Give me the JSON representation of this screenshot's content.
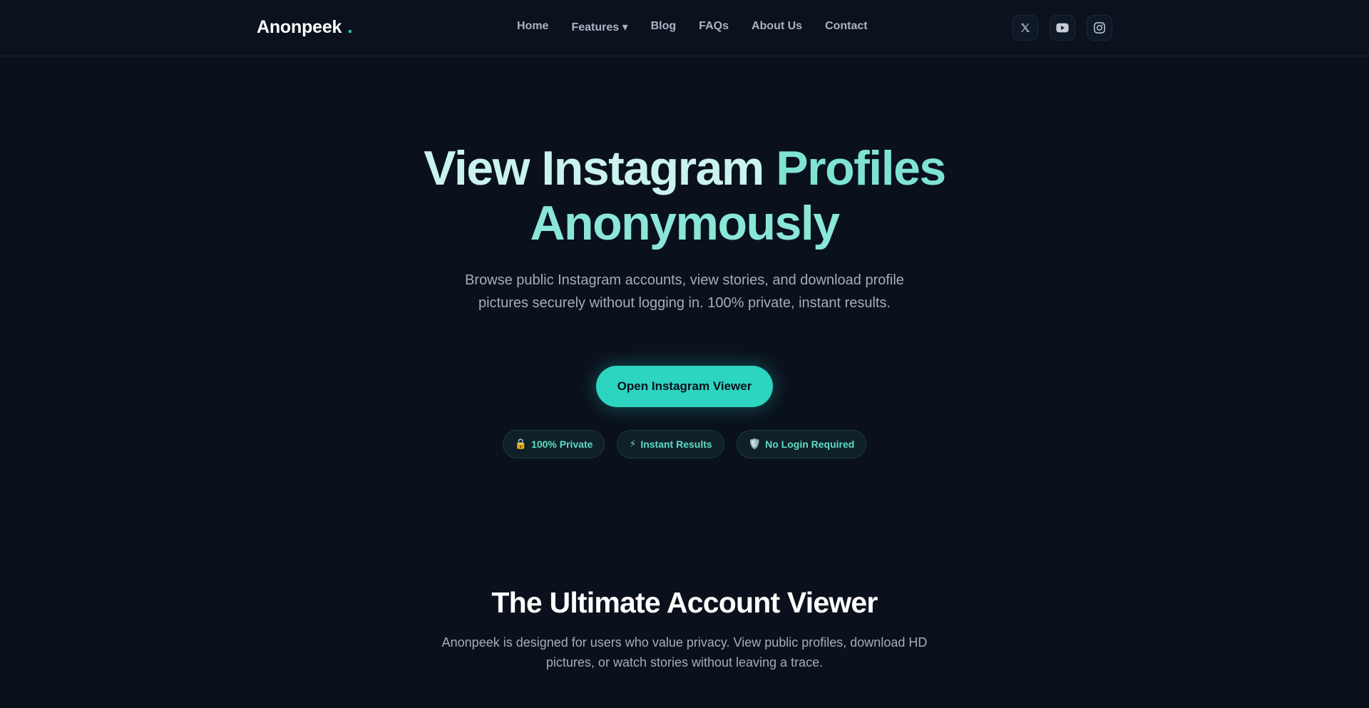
{
  "brand": {
    "name": "Anonpeek",
    "dot": ".",
    "accent_color": "#2dd4bf"
  },
  "nav": {
    "items": [
      {
        "label": "Home"
      },
      {
        "label": "Features ▾"
      },
      {
        "label": "Blog"
      },
      {
        "label": "FAQs"
      },
      {
        "label": "About Us"
      },
      {
        "label": "Contact"
      }
    ]
  },
  "socials": [
    {
      "icon": "x-twitter-icon"
    },
    {
      "icon": "youtube-icon"
    },
    {
      "icon": "instagram-icon"
    }
  ],
  "hero": {
    "title_part1": "View Instagram",
    "title_part2": "Profiles",
    "title_line2": "Anonymously",
    "subtitle": "Browse public Instagram accounts, view stories, and download profile pictures securely without logging in. 100% private, instant results.",
    "cta_label": "Open Instagram Viewer",
    "badges": [
      {
        "emoji": "🔒",
        "label": "100% Private"
      },
      {
        "emoji": "⚡",
        "label": "Instant Results"
      },
      {
        "emoji": "🛡️",
        "label": "No Login Required"
      }
    ]
  },
  "section": {
    "title": "The Ultimate Account Viewer",
    "subtitle": "Anonpeek is designed for users who value privacy. View public profiles, download HD pictures, or watch stories without leaving a trace."
  },
  "colors": {
    "background": "#0a111d",
    "accent": "#2dd4bf",
    "title_light": "#cbf3ee",
    "title_accent": "#8ae6d8"
  }
}
